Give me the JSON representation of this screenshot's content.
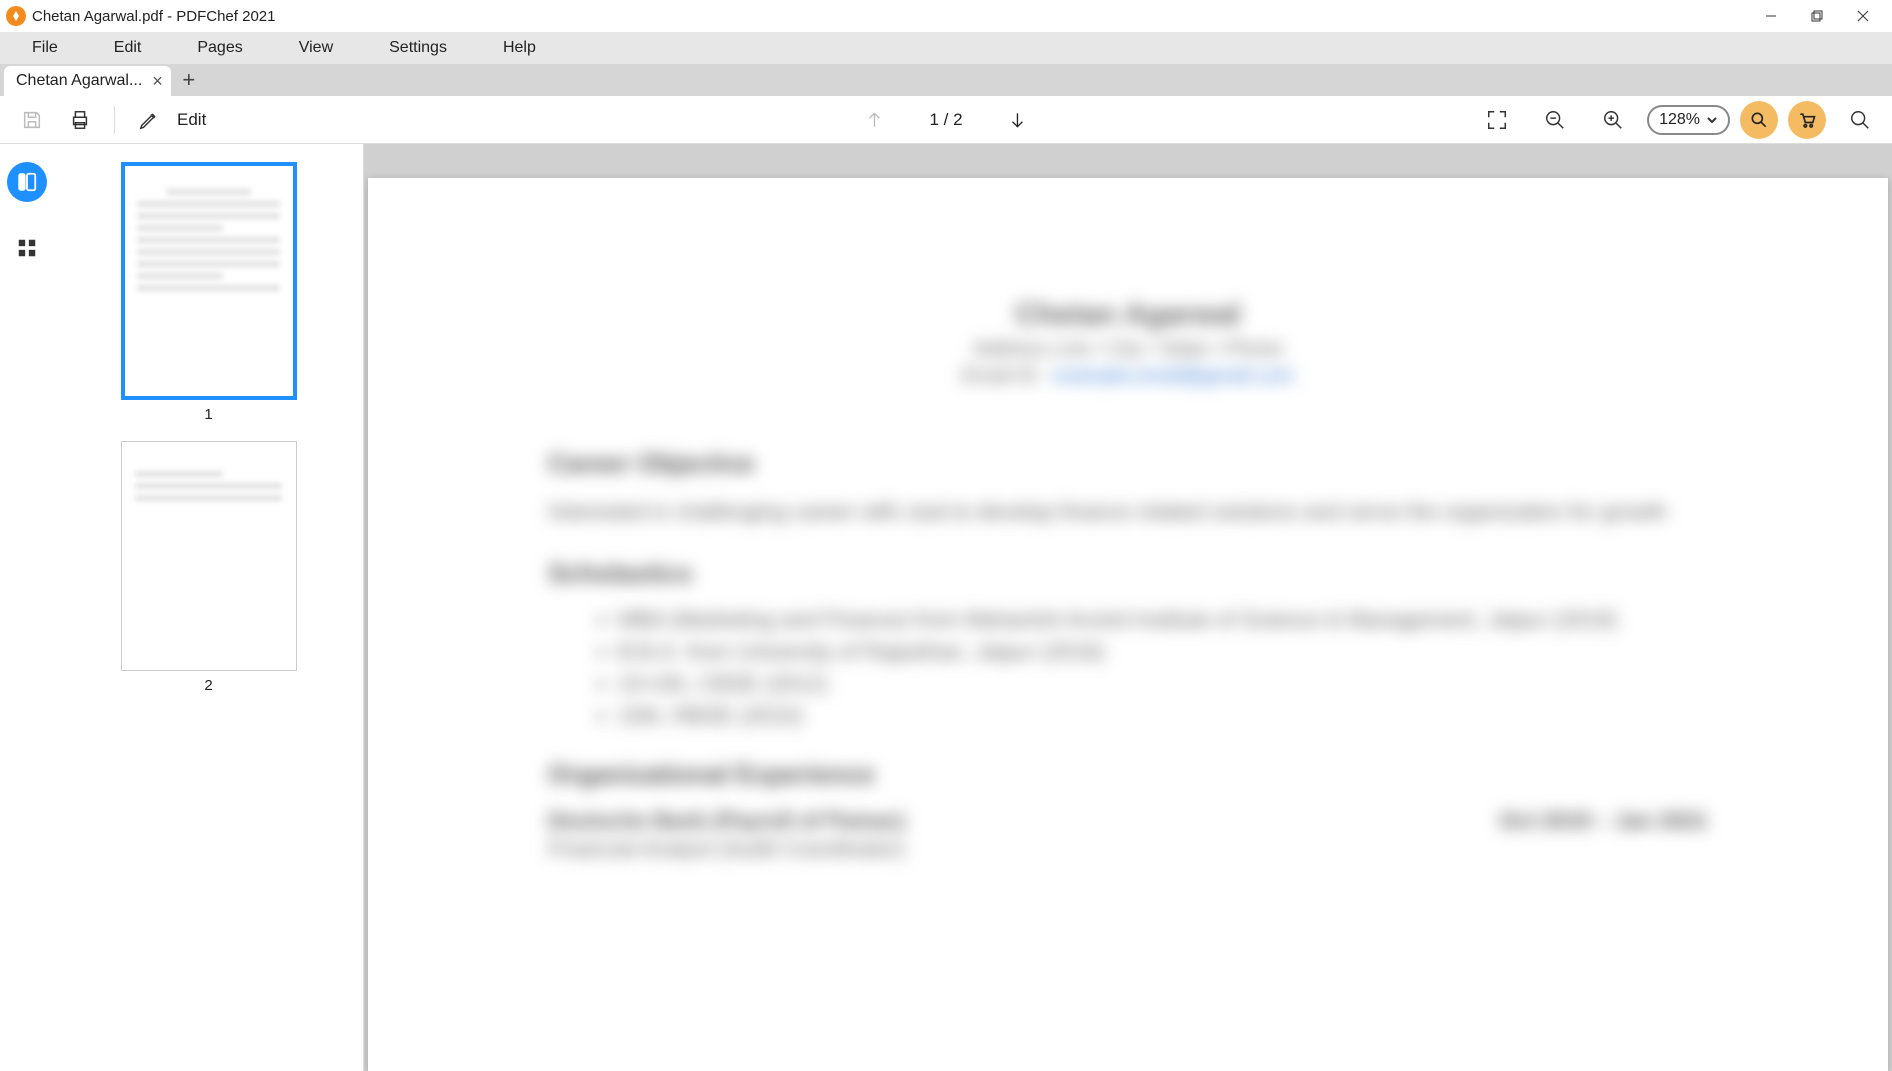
{
  "window": {
    "title": "Chetan Agarwal.pdf - PDFChef 2021"
  },
  "menu": {
    "items": [
      "File",
      "Edit",
      "Pages",
      "View",
      "Settings",
      "Help"
    ]
  },
  "tabs": {
    "active_label": "Chetan Agarwal..."
  },
  "toolbar": {
    "edit_label": "Edit",
    "page_counter": "1 / 2",
    "zoom": "128%"
  },
  "thumbnails": {
    "page1": "1",
    "page2": "2"
  },
  "document": {
    "header": {
      "name": "Chetan Agarwal",
      "contact": "Address Line • City • State • Phone",
      "email_label": "Email ID : ",
      "email": "example.email@gmail.com"
    },
    "section1_title": "Career Objective",
    "section1_body": "Interested in challenging career with zeal to develop finance related solutions and serve the organization for growth",
    "section2_title": "Scholastics",
    "section2_items": [
      "MBA (Marketing and Finance) from Maharishi Arvind Institute of Science & Management, Jaipur (2019)",
      "B.B.A. from University of Rajasthan, Jaipur (2016)",
      "10+2th, CBSE (2012)",
      "10th, RBSE (2010)"
    ],
    "section3_title": "Organizational Experience",
    "job1_company": "Deutsche Bank (Payroll of Pamac)",
    "job1_dates": "Oct 2019 – Jan 2021",
    "job1_role": "Financial Analyst (Audit Coordinator)"
  }
}
